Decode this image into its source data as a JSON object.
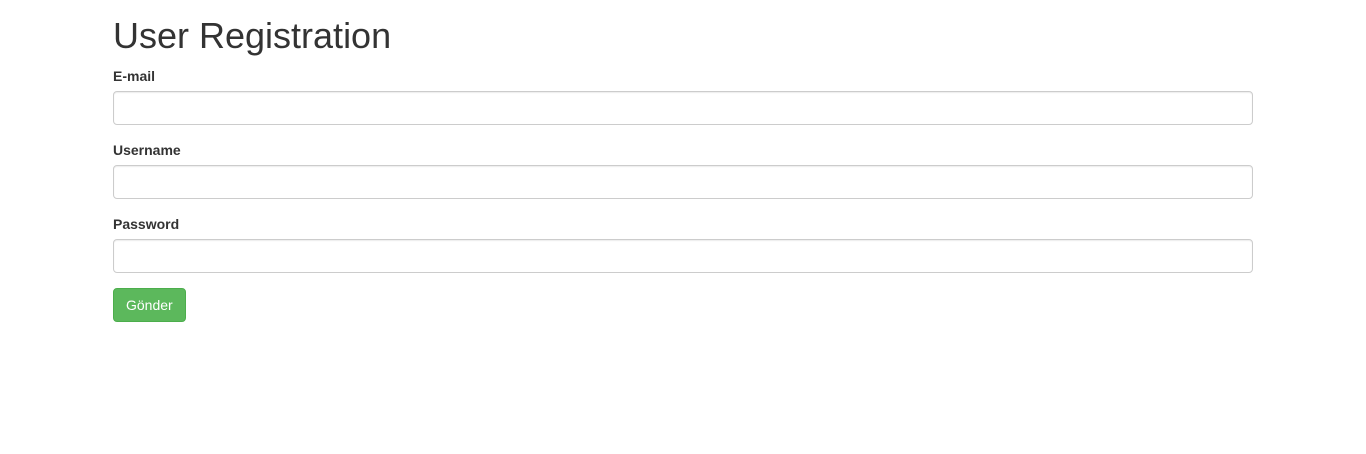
{
  "page": {
    "title": "User Registration"
  },
  "form": {
    "email": {
      "label": "E-mail",
      "value": "",
      "placeholder": ""
    },
    "username": {
      "label": "Username",
      "value": "",
      "placeholder": ""
    },
    "password": {
      "label": "Password",
      "value": "",
      "placeholder": ""
    },
    "submit_label": "Gönder"
  },
  "colors": {
    "primary_button": "#5cb85c",
    "text": "#333333",
    "input_border": "#cccccc"
  }
}
